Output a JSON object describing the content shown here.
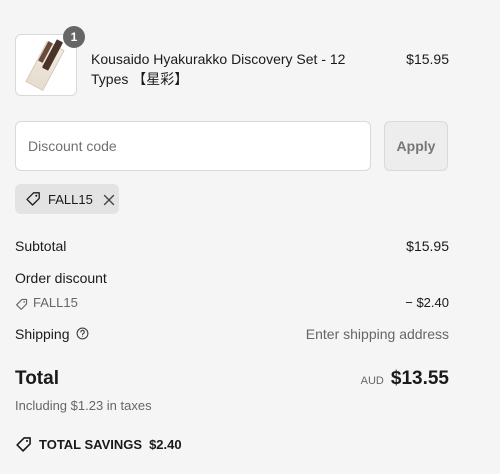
{
  "product": {
    "name": "Kousaido Hyakurakko Discovery Set - 12 Types 【星彩】",
    "price": "$15.95",
    "quantity": "1"
  },
  "discount": {
    "placeholder": "Discount code",
    "apply_label": "Apply",
    "applied_code": "FALL15"
  },
  "summary": {
    "subtotal_label": "Subtotal",
    "subtotal_value": "$15.95",
    "order_discount_label": "Order discount",
    "discount_code": "FALL15",
    "discount_amount": "− $2.40",
    "shipping_label": "Shipping",
    "shipping_value": "Enter shipping address",
    "total_label": "Total",
    "currency": "AUD",
    "total_value": "$13.55",
    "taxes_note": "Including $1.23 in taxes",
    "savings_label": "TOTAL SAVINGS",
    "savings_value": "$2.40"
  },
  "icons": {
    "tag": "tag-icon",
    "close": "close-icon",
    "help": "question-circle-icon",
    "savings": "tag-icon"
  }
}
